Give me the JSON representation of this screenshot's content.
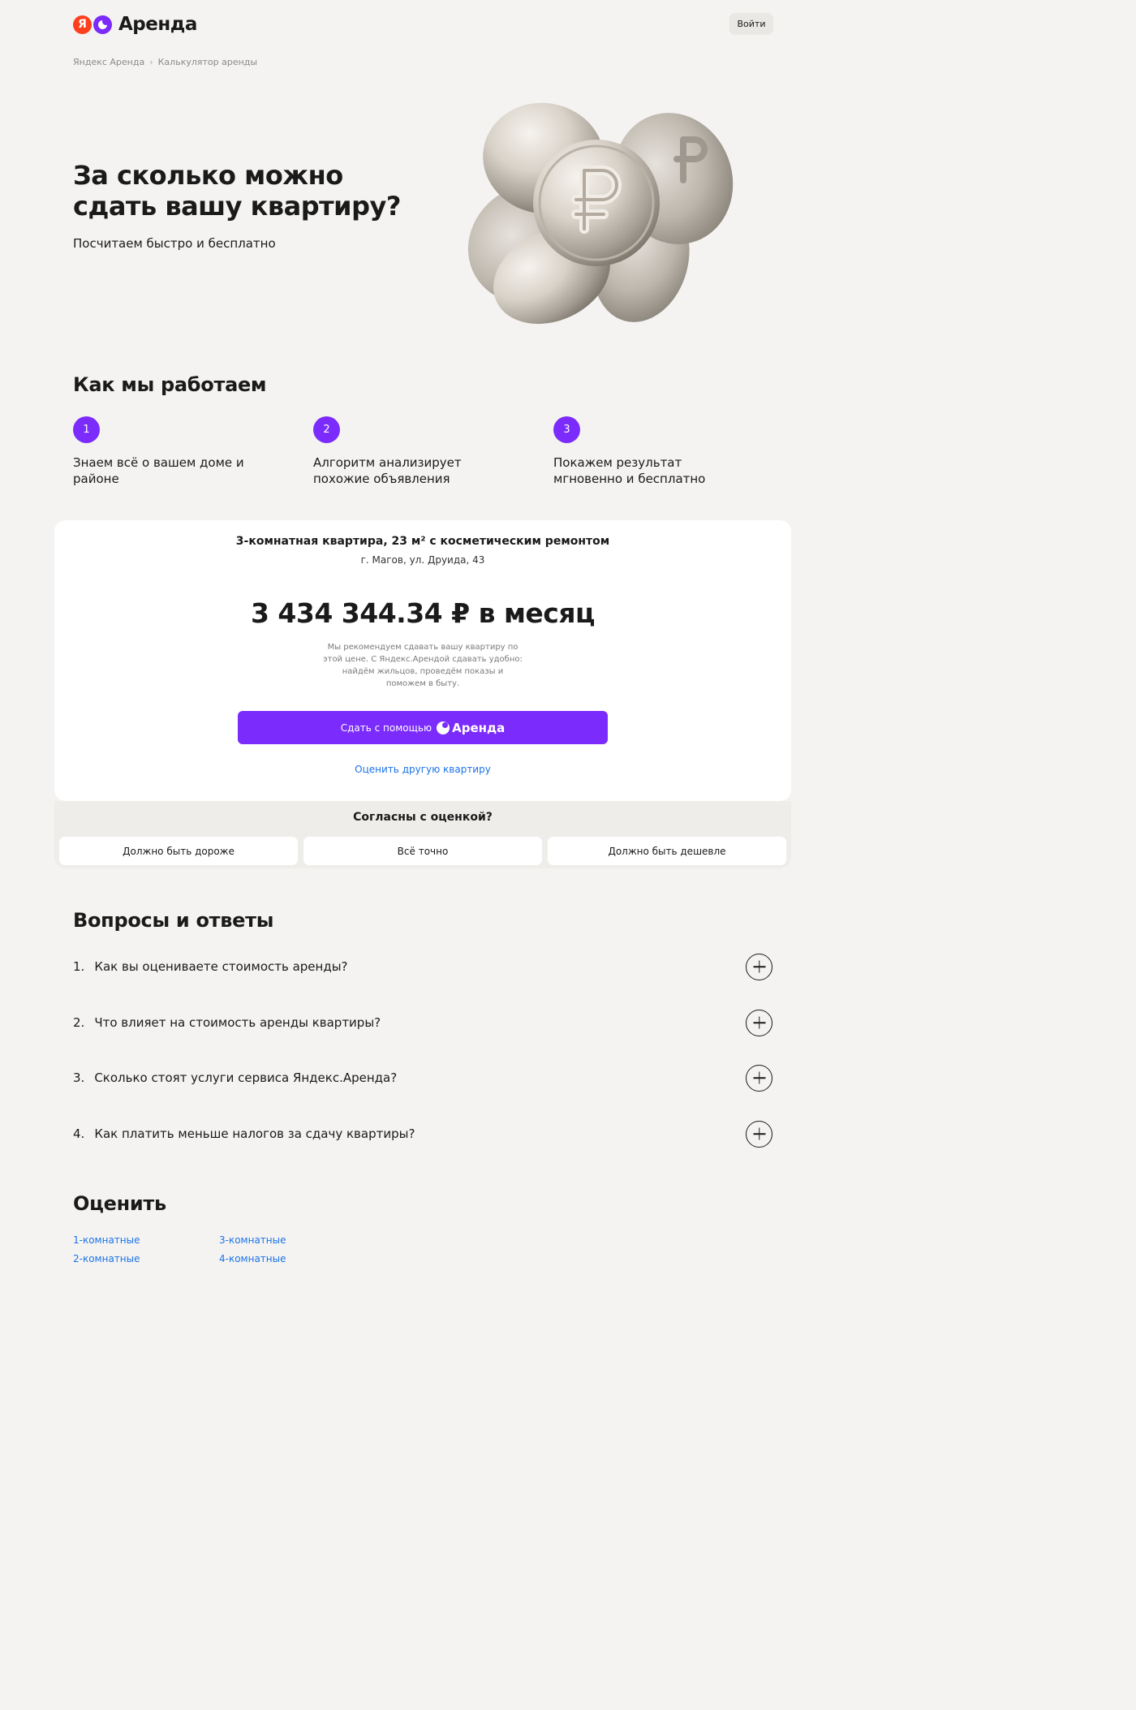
{
  "header": {
    "logo_ya": "Я",
    "logo_text": "Аренда",
    "login_label": "Войти"
  },
  "breadcrumb": {
    "items": [
      "Яндекс Аренда",
      "Калькулятор аренды"
    ],
    "separator": "›"
  },
  "hero": {
    "title": "За сколько можно сдать вашу квартиру?",
    "subtitle": "Посчитаем быстро и бесплатно"
  },
  "how": {
    "title": "Как мы работаем",
    "steps": [
      {
        "num": "1",
        "text": "Знаем всё о вашем доме и районе"
      },
      {
        "num": "2",
        "text": "Алгоритм анализирует похожие объявления"
      },
      {
        "num": "3",
        "text": "Покажем результат мгновенно и бесплатно"
      }
    ]
  },
  "result": {
    "flat": "3-комнатная квартира, 23 м² с косметическим ремонтом",
    "address": "г. Магов, ул. Друида, 43",
    "price": "3 434 344.34 ₽ в месяц",
    "note": "Мы рекомендуем сдавать вашу квартиру по этой цене. С Яндекс.Арендой сдавать удобно: найдём жильцов, проведём показы и поможем в быту.",
    "cta_prefix": "Сдать с помощью",
    "cta_brand": "Аренда",
    "other_link": "Оценить другую квартиру"
  },
  "feedback": {
    "title": "Согласны с оценкой?",
    "options": [
      "Должно быть дороже",
      "Всё точно",
      "Должно быть дешевле"
    ]
  },
  "faq": {
    "title": "Вопросы и ответы",
    "items": [
      {
        "num": "1.",
        "q": "Как вы оцениваете стоимость аренды?"
      },
      {
        "num": "2.",
        "q": "Что влияет на стоимость аренды квартиры?"
      },
      {
        "num": "3.",
        "q": "Сколько стоят услуги сервиса Яндекс.Аренда?"
      },
      {
        "num": "4.",
        "q": "Как платить меньше налогов за сдачу квартиры?"
      }
    ]
  },
  "estimate": {
    "title": "Оценить",
    "links": [
      "1-комнатные",
      "2-комнатные",
      "3-комнатные",
      "4-комнатные"
    ]
  },
  "colors": {
    "accent": "#7b2bfb",
    "link": "#1a73e8",
    "background": "#f4f3f1",
    "yandex_red": "#fc3f1d"
  },
  "icons": {
    "coins": "ruble-coins-illustration",
    "plus": "plus-icon"
  }
}
